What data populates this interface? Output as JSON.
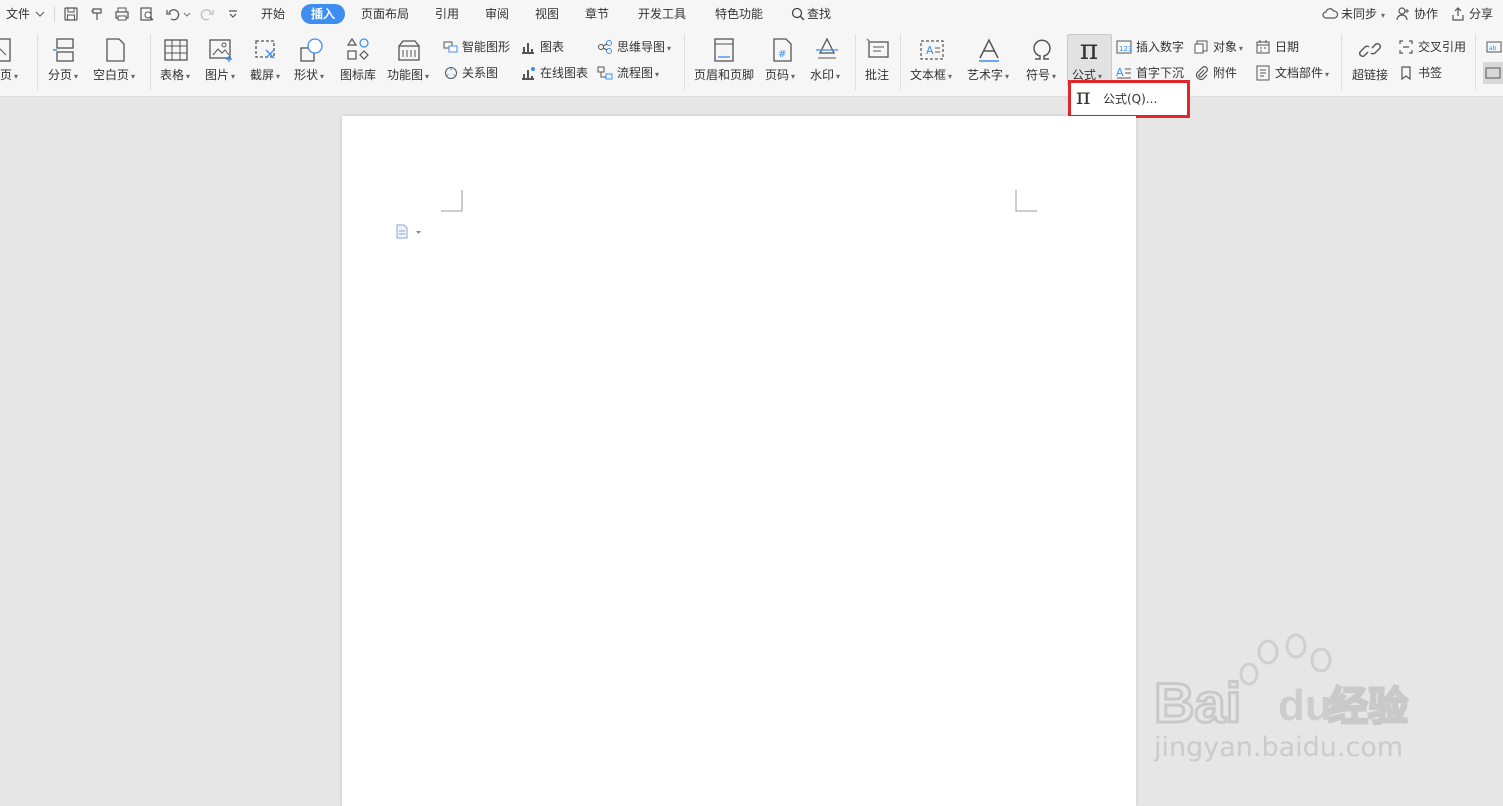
{
  "menubar": {
    "file": "文件",
    "tabs": [
      "开始",
      "插入",
      "页面布局",
      "引用",
      "审阅",
      "视图",
      "章节",
      "开发工具",
      "特色功能"
    ],
    "search": "查找",
    "sync": "未同步",
    "collab": "协作",
    "share": "分享"
  },
  "ribbon": {
    "cover_page": "页",
    "page_break": "分页",
    "blank_page": "空白页",
    "table": "表格",
    "picture": "图片",
    "screenshot": "截屏",
    "shape": "形状",
    "icon_lib": "图标库",
    "func_chart": "功能图",
    "smart_art": "智能图形",
    "chart": "图表",
    "mind_map": "思维导图",
    "relation": "关系图",
    "online_chart": "在线图表",
    "flowchart": "流程图",
    "header_footer": "页眉和页脚",
    "page_number": "页码",
    "watermark": "水印",
    "comment": "批注",
    "textbox": "文本框",
    "wordart": "艺术字",
    "symbol": "符号",
    "formula": "公式",
    "insert_number": "插入数字",
    "drop_cap": "首字下沉",
    "object": "对象",
    "attachment": "附件",
    "date": "日期",
    "doc_parts": "文档部件",
    "hyperlink": "超链接",
    "cross_ref": "交叉引用",
    "bookmark": "书签",
    "formula_glyph": "π"
  },
  "dropdown": {
    "item": "公式(Q)...",
    "glyph": "π",
    "highlight_color": "#e3262b"
  },
  "accent_color": "#3d8ef0",
  "watermark": {
    "brand": "Bai",
    "brand_suffix": "du",
    "cn": "经验",
    "url": "jingyan.baidu.com"
  }
}
